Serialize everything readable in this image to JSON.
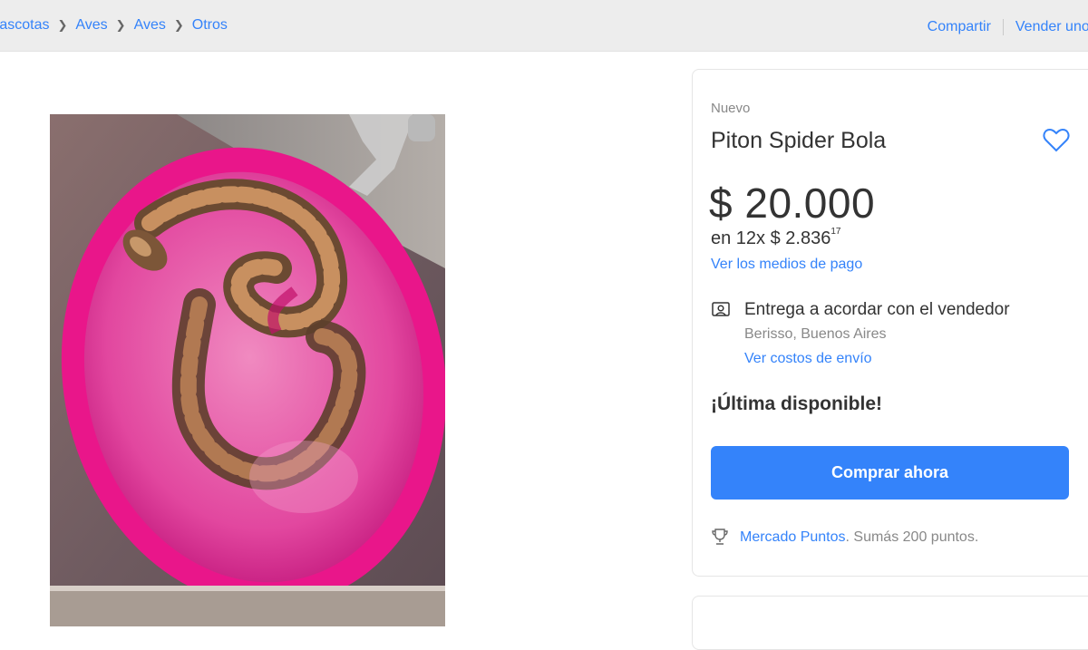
{
  "breadcrumb": {
    "items": [
      "Mascotas",
      "Aves",
      "Aves",
      "Otros"
    ]
  },
  "top_actions": {
    "share": "Compartir",
    "sell": "Vender uno igual"
  },
  "product": {
    "condition": "Nuevo",
    "title": "Piton Spider Bola",
    "price": "$ 20.000",
    "installments_prefix": "en 12x $ 2.836",
    "installments_cents": "17",
    "payment_link": "Ver los medios de pago",
    "shipping_title": "Entrega a acordar con el vendedor",
    "shipping_location": "Berisso, Buenos Aires",
    "shipping_link": "Ver costos de envío",
    "stock_text": "¡Última disponible!",
    "buy_button": "Comprar ahora",
    "points_link": "Mercado Puntos",
    "points_text": ". Sumás 200 puntos."
  },
  "colors": {
    "accent": "#3483fa",
    "topbar": "#ededed",
    "image_bowl": "#e9168a"
  },
  "icons": [
    "chevron-right-icon",
    "heart-icon",
    "shipping-icon",
    "trophy-icon"
  ]
}
